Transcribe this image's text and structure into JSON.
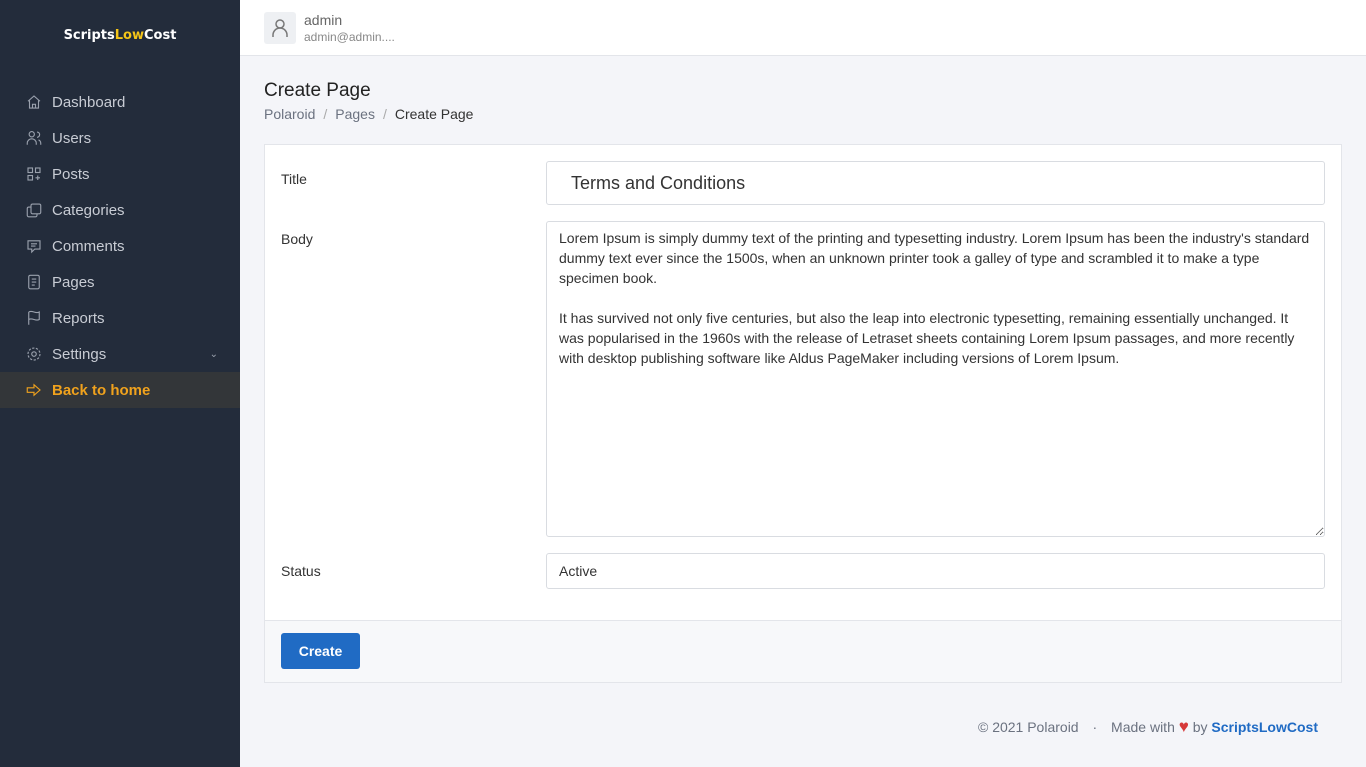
{
  "brand": {
    "part1": "Scripts",
    "part2": "Low",
    "part3": "Cost"
  },
  "nav": [
    {
      "label": "Dashboard"
    },
    {
      "label": "Users"
    },
    {
      "label": "Posts"
    },
    {
      "label": "Categories"
    },
    {
      "label": "Comments"
    },
    {
      "label": "Pages"
    },
    {
      "label": "Reports"
    },
    {
      "label": "Settings"
    },
    {
      "label": "Back to home"
    }
  ],
  "user": {
    "name": "admin",
    "email": "admin@admin...."
  },
  "page": {
    "title": "Create Page",
    "breadcrumb": [
      "Polaroid",
      "Pages",
      "Create Page"
    ]
  },
  "form": {
    "title_label": "Title",
    "title_value": "Terms and Conditions",
    "body_label": "Body",
    "body_value": "Lorem Ipsum is simply dummy text of the printing and typesetting industry. Lorem Ipsum has been the industry's standard dummy text ever since the 1500s, when an unknown printer took a galley of type and scrambled it to make a type specimen book.\n\nIt has survived not only five centuries, but also the leap into electronic typesetting, remaining essentially unchanged. It was popularised in the 1960s with the release of Letraset sheets containing Lorem Ipsum passages, and more recently with desktop publishing software like Aldus PageMaker including versions of Lorem Ipsum.",
    "status_label": "Status",
    "status_value": "Active",
    "create_label": "Create"
  },
  "footer": {
    "copyright": "© 2021 Polaroid",
    "dot": "·",
    "made_with": "Made with",
    "heart": "♥",
    "by": "by",
    "brand": "ScriptsLowCost"
  }
}
